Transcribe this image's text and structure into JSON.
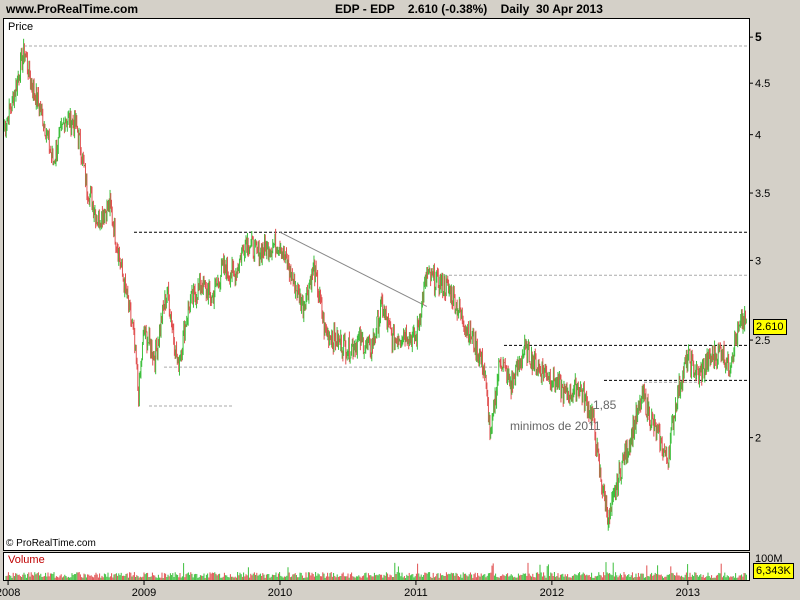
{
  "header": {
    "site": "www.ProRealTime.com",
    "title": "EDP - EDP    2.610 (-0.38%)    Daily  30 Apr 2013"
  },
  "price_panel": {
    "label": "Price",
    "copyright": "© ProRealTime.com"
  },
  "volume_panel": {
    "label": "Volume",
    "max_label": "100M",
    "current_value": "6,343K"
  },
  "annotations": {
    "note_value": "1,85",
    "note_text": "minimos de 2011"
  },
  "current_price_label": "2.610",
  "colors": {
    "up": "#3cbf3c",
    "down": "#e05050",
    "badge": "#ffff00"
  },
  "chart_data": {
    "type": "line",
    "y_scale": "log",
    "ylim": [
      1.55,
      5.2
    ],
    "y_ticks": [
      {
        "value": 5,
        "label": "5"
      },
      {
        "value": 4.5,
        "label": "4.5"
      },
      {
        "value": 4,
        "label": "4"
      },
      {
        "value": 3.5,
        "label": "3.5"
      },
      {
        "value": 3,
        "label": "3"
      },
      {
        "value": 2.5,
        "label": "2.5"
      },
      {
        "value": 2,
        "label": "2"
      }
    ],
    "x_ticks": [
      "2008",
      "2009",
      "2010",
      "2011",
      "2012",
      "2013"
    ],
    "xlim": [
      2007.97,
      2013.45
    ],
    "series": [
      {
        "values": [
          [
            2007.97,
            4.05
          ],
          [
            2008.03,
            4.3
          ],
          [
            2008.08,
            4.6
          ],
          [
            2008.12,
            4.85
          ],
          [
            2008.17,
            4.5
          ],
          [
            2008.25,
            4.2
          ],
          [
            2008.33,
            3.75
          ],
          [
            2008.42,
            4.15
          ],
          [
            2008.5,
            4.1
          ],
          [
            2008.58,
            3.55
          ],
          [
            2008.66,
            3.3
          ],
          [
            2008.75,
            3.4
          ],
          [
            2008.83,
            2.95
          ],
          [
            2008.92,
            2.55
          ],
          [
            2008.96,
            2.2
          ],
          [
            2009.0,
            2.55
          ],
          [
            2009.08,
            2.4
          ],
          [
            2009.17,
            2.8
          ],
          [
            2009.25,
            2.35
          ],
          [
            2009.33,
            2.7
          ],
          [
            2009.42,
            2.85
          ],
          [
            2009.5,
            2.75
          ],
          [
            2009.58,
            2.95
          ],
          [
            2009.67,
            2.9
          ],
          [
            2009.75,
            3.15
          ],
          [
            2009.83,
            3.05
          ],
          [
            2009.92,
            3.1
          ],
          [
            2010.0,
            3.12
          ],
          [
            2010.08,
            2.9
          ],
          [
            2010.17,
            2.7
          ],
          [
            2010.25,
            2.95
          ],
          [
            2010.33,
            2.55
          ],
          [
            2010.42,
            2.5
          ],
          [
            2010.5,
            2.45
          ],
          [
            2010.58,
            2.5
          ],
          [
            2010.67,
            2.45
          ],
          [
            2010.75,
            2.7
          ],
          [
            2010.83,
            2.5
          ],
          [
            2010.92,
            2.55
          ],
          [
            2011.0,
            2.5
          ],
          [
            2011.08,
            2.9
          ],
          [
            2011.17,
            2.85
          ],
          [
            2011.25,
            2.8
          ],
          [
            2011.33,
            2.65
          ],
          [
            2011.42,
            2.5
          ],
          [
            2011.5,
            2.35
          ],
          [
            2011.55,
            2.0
          ],
          [
            2011.62,
            2.4
          ],
          [
            2011.7,
            2.25
          ],
          [
            2011.8,
            2.45
          ],
          [
            2011.9,
            2.35
          ],
          [
            2012.0,
            2.3
          ],
          [
            2012.1,
            2.2
          ],
          [
            2012.2,
            2.25
          ],
          [
            2012.3,
            2.1
          ],
          [
            2012.35,
            1.85
          ],
          [
            2012.42,
            1.65
          ],
          [
            2012.5,
            1.85
          ],
          [
            2012.58,
            2.0
          ],
          [
            2012.67,
            2.2
          ],
          [
            2012.75,
            2.05
          ],
          [
            2012.85,
            1.9
          ],
          [
            2012.92,
            2.2
          ],
          [
            2013.0,
            2.4
          ],
          [
            2013.08,
            2.3
          ],
          [
            2013.17,
            2.4
          ],
          [
            2013.25,
            2.45
          ],
          [
            2013.3,
            2.35
          ],
          [
            2013.35,
            2.5
          ],
          [
            2013.4,
            2.6
          ],
          [
            2013.43,
            2.61
          ]
        ]
      }
    ],
    "horizontal_levels": [
      {
        "y": 4.9,
        "style": "dashed-grey"
      },
      {
        "y": 3.2,
        "style": "dashed-black"
      },
      {
        "y": 2.9,
        "style": "dashed-grey"
      },
      {
        "y": 2.47,
        "style": "dashed-black"
      },
      {
        "y": 2.35,
        "style": "dashed-grey"
      },
      {
        "y": 2.28,
        "style": "dashed-black"
      },
      {
        "y": 2.27,
        "style": "dashed-grey"
      },
      {
        "y": 2.15,
        "style": "dashed-grey"
      }
    ],
    "trend_line": [
      [
        2010.0,
        3.2
      ],
      [
        2011.08,
        2.7
      ]
    ]
  }
}
